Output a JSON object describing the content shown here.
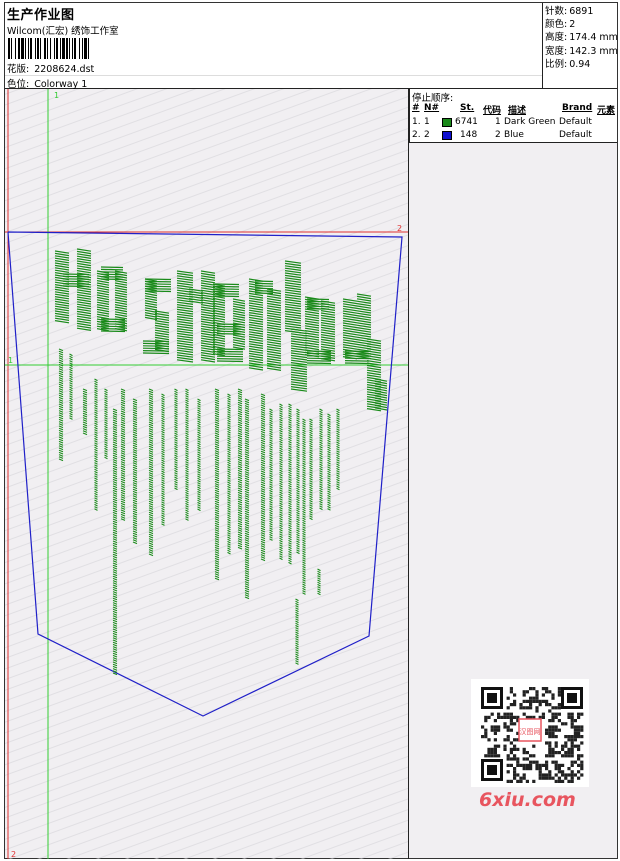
{
  "header": {
    "title": "生产作业图",
    "subtitle": "Wilcom(汇宏) 绣饰工作室",
    "design_label": "花版:",
    "design_value": "2208624.dst",
    "colorway_label": "色位:",
    "colorway_value": "Colorway 1"
  },
  "stats": [
    {
      "label": "针数:",
      "value": "6891"
    },
    {
      "label": "颜色:",
      "value": "2"
    },
    {
      "label": "高度:",
      "value": "174.4 mm"
    },
    {
      "label": "宽度:",
      "value": "142.3 mm"
    },
    {
      "label": "比例:",
      "value": "0.94"
    }
  ],
  "stop_sequence": {
    "heading": "停止顺序:",
    "columns": [
      "#",
      "N#",
      "St.",
      "代码",
      "描述",
      "Brand",
      "元素"
    ],
    "rows": [
      {
        "num": "1.",
        "n": "1",
        "color": "#1a8a1a",
        "stitches": "6741",
        "code": "1",
        "desc": "Dark Green",
        "brand": "Default"
      },
      {
        "num": "2.",
        "n": "2",
        "color": "#1010d0",
        "stitches": "148",
        "code": "2",
        "desc": "Blue",
        "brand": "Default"
      }
    ]
  },
  "guides": {
    "v1_label": "1",
    "h1_label": "1",
    "h2_label": "2",
    "v2_label": "2"
  },
  "watermark": {
    "seal_text": "汉图网",
    "site": "6xiu.com"
  },
  "colors": {
    "thread_green": "#1a8a1a",
    "thread_blue": "#1010d0",
    "guide_green": "#33cc33",
    "guide_red": "#e03030",
    "watermark_red": "#e8555f"
  }
}
